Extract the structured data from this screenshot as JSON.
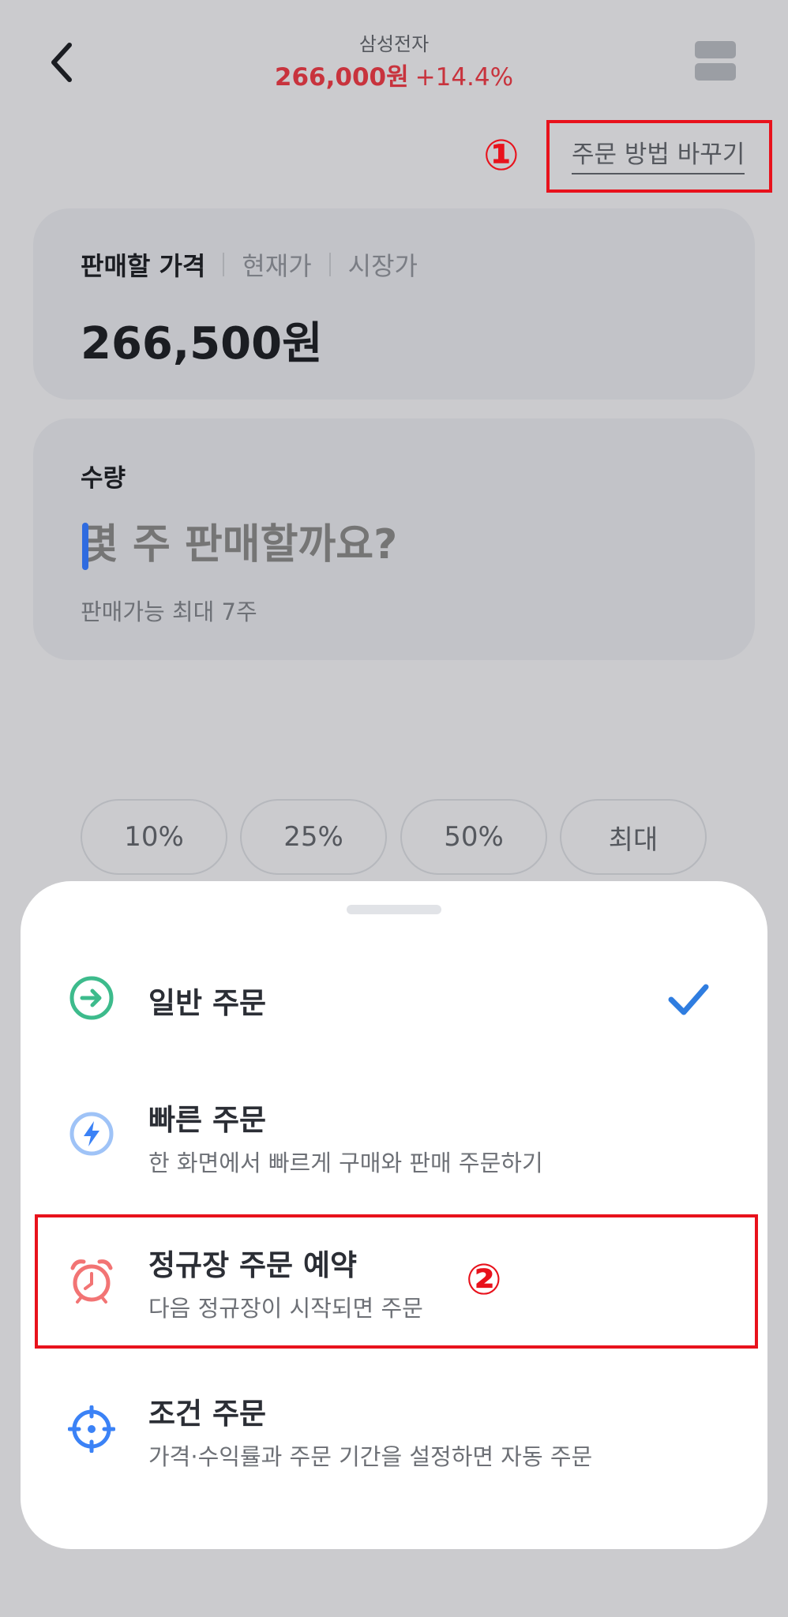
{
  "header": {
    "stock_name": "삼성전자",
    "price": "266,000원",
    "change": "+14.4%"
  },
  "annotations": {
    "one": "①",
    "two": "②"
  },
  "order_method": {
    "change_label": "주문 방법 바꾸기"
  },
  "price_card": {
    "tabs": [
      "판매할 가격",
      "현재가",
      "시장가"
    ],
    "value": "266,500원"
  },
  "quantity_card": {
    "label": "수량",
    "placeholder": "몇 주 판매할까요?",
    "sub": "판매가능 최대 7주"
  },
  "percent_chips": [
    "10%",
    "25%",
    "50%",
    "최대"
  ],
  "sheet": {
    "items": [
      {
        "title": "일반 주문",
        "subtitle": "",
        "icon": "arrow-right-circle-icon",
        "selected": true
      },
      {
        "title": "빠른 주문",
        "subtitle": "한 화면에서 빠르게 구매와 판매 주문하기",
        "icon": "lightning-icon",
        "selected": false
      },
      {
        "title": "정규장 주문 예약",
        "subtitle": "다음 정규장이 시작되면 주문",
        "icon": "alarm-clock-icon",
        "selected": false
      },
      {
        "title": "조건 주문",
        "subtitle": "가격·수익률과 주문 기간을 설정하면 자동 주문",
        "icon": "crosshair-icon",
        "selected": false
      }
    ]
  },
  "colors": {
    "price_red": "#c8333d",
    "annotation_red": "#e8121c",
    "check_blue": "#2f7de0",
    "green": "#3dbb8c",
    "blue": "#3b82f6",
    "alarm_red": "#f27474"
  }
}
